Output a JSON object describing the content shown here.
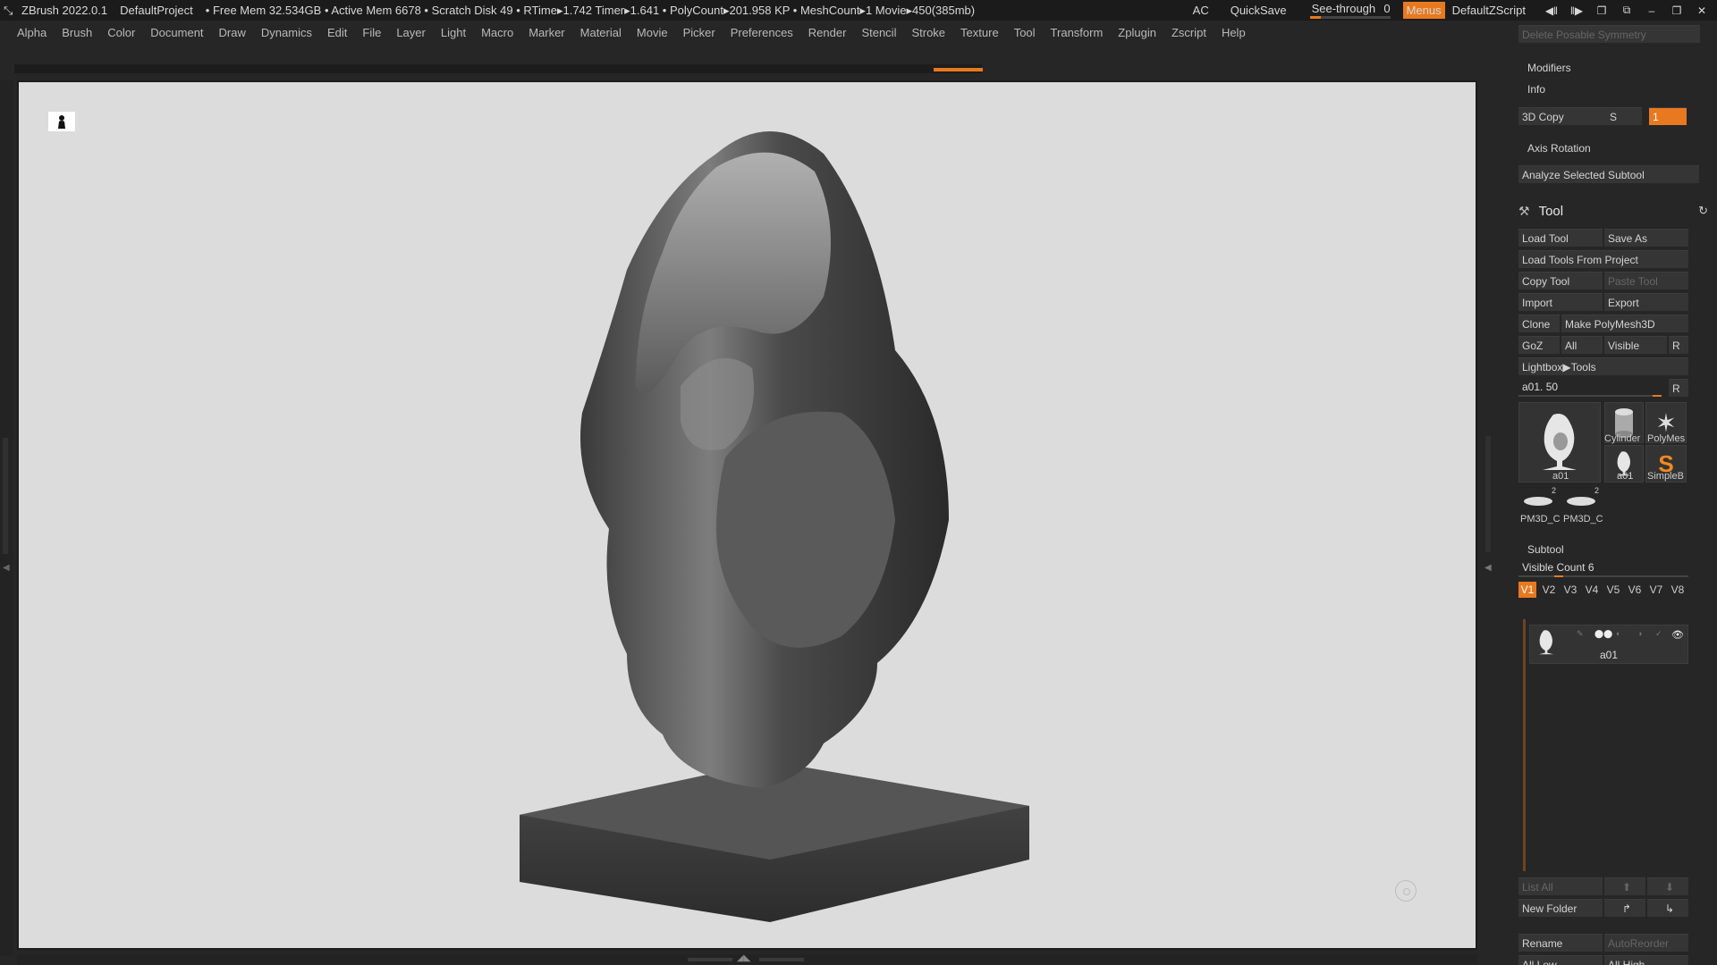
{
  "titlebar": {
    "app_name": "ZBrush 2022.0.1",
    "project": "DefaultProject",
    "stats": "• Free Mem 32.534GB • Active Mem 6678 • Scratch Disk 49 •  RTime▸1.742 Timer▸1.641 • PolyCount▸201.958 KP  • MeshCount▸1  Movie▸450(385mb)",
    "ac": "AC",
    "quicksave": "QuickSave",
    "see_through_label": "See-through",
    "see_through_value": "0",
    "see_through_level": 0,
    "menus": "Menus",
    "script": "DefaultZScript"
  },
  "menubar": {
    "items": [
      "Alpha",
      "Brush",
      "Color",
      "Document",
      "Draw",
      "Dynamics",
      "Edit",
      "File",
      "Layer",
      "Light",
      "Macro",
      "Marker",
      "Material",
      "Movie",
      "Picker",
      "Preferences",
      "Render",
      "Stencil",
      "Stroke",
      "Texture",
      "Tool",
      "Transform",
      "Zplugin",
      "Zscript",
      "Help"
    ]
  },
  "palette": {
    "delete_posable_symmetry": "Delete Posable Symmetry",
    "modifiers": "Modifiers",
    "info": "Info",
    "copy3d": "3D Copy",
    "copy3d_s": "S",
    "copy3d_value": "1",
    "axis_rotation": "Axis Rotation",
    "analyze_selected_subtool": "Analyze Selected Subtool",
    "tool_title": "Tool",
    "load_tool": "Load Tool",
    "save_as": "Save As",
    "load_tools_from_project": "Load Tools From Project",
    "copy_tool": "Copy Tool",
    "paste_tool": "Paste Tool",
    "import": "Import",
    "export": "Export",
    "clone": "Clone",
    "make_polymesh3d": "Make PolyMesh3D",
    "goz": "GoZ",
    "all": "All",
    "visible": "Visible",
    "r": "R",
    "lightbox_tools": "Lightbox▶Tools",
    "tool_slider_label": "a01. 50",
    "tool_slider_r": "R",
    "thumbs": {
      "main": "a01",
      "cylinder": "Cylinder",
      "polymesh": "PolyMes",
      "a01_small": "a01",
      "simpleb": "SimpleB",
      "pm3d_1": "PM3D_C",
      "pm3d_2": "PM3D_C",
      "pm3d_count_1": "2",
      "pm3d_count_2": "2"
    },
    "subtool_title": "Subtool",
    "visible_count": "Visible Count 6",
    "versions": [
      "V1",
      "V2",
      "V3",
      "V4",
      "V5",
      "V6",
      "V7",
      "V8"
    ],
    "subtool_item": "a01",
    "list_all": "List All",
    "new_folder": "New Folder",
    "rename": "Rename",
    "auto_reorder": "AutoReorder",
    "all_low": "All Low",
    "all_high": "All High"
  },
  "colors": {
    "accent": "#e8791f",
    "viewport_bg": "#dcdcdc",
    "ui_bg": "#262626"
  }
}
